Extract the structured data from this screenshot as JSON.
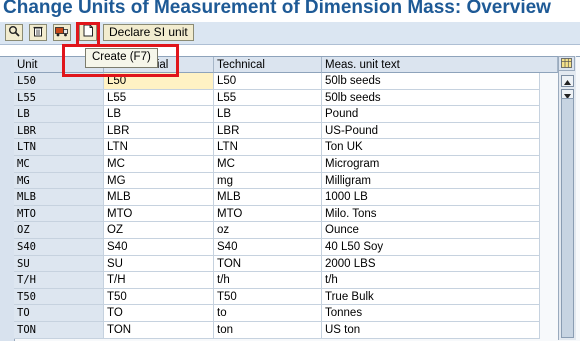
{
  "title": "Change Units of Measurement of Dimension Mass: Overview",
  "toolbar": {
    "declare_label": "Declare SI unit",
    "icons": [
      "details-icon",
      "delete-icon",
      "transport-icon",
      "create-icon"
    ]
  },
  "tooltip": "Create   (F7)",
  "table": {
    "headers": [
      "Unit",
      "Commercial",
      "Technical",
      "Meas. unit text"
    ],
    "rows": [
      {
        "unit": "L50",
        "commercial": "L50",
        "technical": "L50",
        "text": "50lb seeds"
      },
      {
        "unit": "L55",
        "commercial": "L55",
        "technical": "L55",
        "text": "50lb seeds"
      },
      {
        "unit": "LB",
        "commercial": "LB",
        "technical": "LB",
        "text": "Pound"
      },
      {
        "unit": "LBR",
        "commercial": "LBR",
        "technical": "LBR",
        "text": "US-Pound"
      },
      {
        "unit": "LTN",
        "commercial": "LTN",
        "technical": "LTN",
        "text": "Ton UK"
      },
      {
        "unit": "MC",
        "commercial": "MC",
        "technical": "MC",
        "text": "Microgram"
      },
      {
        "unit": "MG",
        "commercial": "MG",
        "technical": "mg",
        "text": "Milligram"
      },
      {
        "unit": "MLB",
        "commercial": "MLB",
        "technical": "MLB",
        "text": "1000 LB"
      },
      {
        "unit": "MTO",
        "commercial": "MTO",
        "technical": "MTO",
        "text": "Milo. Tons"
      },
      {
        "unit": "OZ",
        "commercial": "OZ",
        "technical": "oz",
        "text": "Ounce"
      },
      {
        "unit": "S40",
        "commercial": "S40",
        "technical": "S40",
        "text": "40 L50 Soy"
      },
      {
        "unit": "SU",
        "commercial": "SU",
        "technical": "TON",
        "text": "2000 LBS"
      },
      {
        "unit": "T/H",
        "commercial": "T/H",
        "technical": "t/h",
        "text": "t/h"
      },
      {
        "unit": "T50",
        "commercial": "T50",
        "technical": "T50",
        "text": "True Bulk"
      },
      {
        "unit": "TO",
        "commercial": "TO",
        "technical": "to",
        "text": "Tonnes"
      },
      {
        "unit": "TON",
        "commercial": "TON",
        "technical": "ton",
        "text": "US ton"
      }
    ]
  },
  "colors": {
    "title": "#1e5a96",
    "highlight": "#e0151b",
    "selected_cell": "#fff2c4"
  }
}
